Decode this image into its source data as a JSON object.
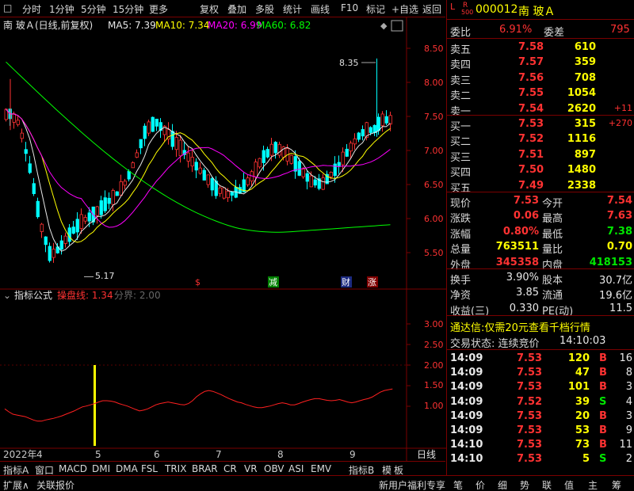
{
  "toolbar": {
    "items": [
      "分时",
      "1分钟",
      "5分钟",
      "15分钟",
      "更多",
      "复权",
      "叠加",
      "多股",
      "统计",
      "画线",
      "F10",
      "标记",
      "+自选",
      "返回"
    ]
  },
  "chart_header": {
    "name": "南 玻Ａ",
    "mode": "(日线,前复权)",
    "ma5": "MA5: 7.39",
    "ma10": "MA10: 7.34",
    "ma20": "MA20: 6.99",
    "ma60": "MA60: 6.82"
  },
  "indicator_header": {
    "title": "指标公式",
    "line_label": "操盘线: 1.34",
    "boundary_label": "分界: 2.00"
  },
  "markers": {
    "high": "8.35",
    "low": "5.17",
    "s_flag": "$",
    "jian": "减",
    "cai": "财",
    "zhang": "涨"
  },
  "chart_data": {
    "type": "candlestick",
    "price_axis": {
      "ticks": [
        "8.50",
        "8.00",
        "7.50",
        "7.00",
        "6.50",
        "6.00",
        "5.50"
      ],
      "min": 5.2,
      "max": 8.5
    },
    "indicator_axis": {
      "ticks": [
        "3.00",
        "2.50",
        "2.00",
        "1.50",
        "1.00"
      ]
    },
    "x_axis": {
      "ticks": [
        "2022年",
        "4",
        "5",
        "6",
        "7",
        "8",
        "9"
      ],
      "period_label": "日线"
    },
    "indicator_values": {
      "operation_line": 1.34,
      "boundary": 2.0
    }
  },
  "stock": {
    "code": "000012",
    "name": "南 玻Ａ",
    "badge_top": "R",
    "badge_mid": "500"
  },
  "order_ratio": {
    "label1": "委比",
    "value1": "6.91%",
    "label2": "委差",
    "value2": "795"
  },
  "asks": [
    {
      "label": "卖五",
      "price": "7.58",
      "vol": "610",
      "chg": ""
    },
    {
      "label": "卖四",
      "price": "7.57",
      "vol": "359",
      "chg": ""
    },
    {
      "label": "卖三",
      "price": "7.56",
      "vol": "708",
      "chg": ""
    },
    {
      "label": "卖二",
      "price": "7.55",
      "vol": "1054",
      "chg": ""
    },
    {
      "label": "卖一",
      "price": "7.54",
      "vol": "2620",
      "chg": "+11"
    }
  ],
  "bids": [
    {
      "label": "买一",
      "price": "7.53",
      "vol": "315",
      "chg": "+270"
    },
    {
      "label": "买二",
      "price": "7.52",
      "vol": "1116",
      "chg": ""
    },
    {
      "label": "买三",
      "price": "7.51",
      "vol": "897",
      "chg": ""
    },
    {
      "label": "买四",
      "price": "7.50",
      "vol": "1480",
      "chg": ""
    },
    {
      "label": "买五",
      "price": "7.49",
      "vol": "2338",
      "chg": ""
    }
  ],
  "stats": [
    {
      "l1": "现价",
      "v1": "7.53",
      "c1": "red",
      "l2": "今开",
      "v2": "7.54",
      "c2": "red"
    },
    {
      "l1": "涨跌",
      "v1": "0.06",
      "c1": "red",
      "l2": "最高",
      "v2": "7.63",
      "c2": "red"
    },
    {
      "l1": "涨幅",
      "v1": "0.80%",
      "c1": "red",
      "l2": "最低",
      "v2": "7.38",
      "c2": "grn"
    },
    {
      "l1": "总量",
      "v1": "763511",
      "c1": "yel",
      "l2": "量比",
      "v2": "0.70",
      "c2": "yel"
    },
    {
      "l1": "外盘",
      "v1": "345358",
      "c1": "red",
      "l2": "内盘",
      "v2": "418153",
      "c2": "grn"
    }
  ],
  "stats2": [
    {
      "l1": "换手",
      "v1": "3.90%",
      "l2": "股本",
      "v2": "30.7亿"
    },
    {
      "l1": "净资",
      "v1": "3.85",
      "l2": "流通",
      "v2": "19.6亿"
    },
    {
      "l1": "收益(三)",
      "v1": "0.330",
      "l2": "PE(动)",
      "v2": "11.5"
    }
  ],
  "promo": "通达信:仅需20元查看千档行情",
  "trade_status": {
    "label": "交易状态: 连续竞价",
    "time": "14:10:03"
  },
  "ticks": [
    {
      "t": "14:09",
      "p": "7.53",
      "v": "120",
      "bs": "B",
      "n": "16"
    },
    {
      "t": "14:09",
      "p": "7.53",
      "v": "47",
      "bs": "B",
      "n": "8"
    },
    {
      "t": "14:09",
      "p": "7.53",
      "v": "101",
      "bs": "B",
      "n": "3"
    },
    {
      "t": "14:09",
      "p": "7.52",
      "v": "39",
      "bs": "S",
      "n": "4"
    },
    {
      "t": "14:09",
      "p": "7.53",
      "v": "20",
      "bs": "B",
      "n": "3"
    },
    {
      "t": "14:09",
      "p": "7.53",
      "v": "53",
      "bs": "B",
      "n": "9"
    },
    {
      "t": "14:10",
      "p": "7.53",
      "v": "73",
      "bs": "B",
      "n": "11"
    },
    {
      "t": "14:10",
      "p": "7.53",
      "v": "5",
      "bs": "S",
      "n": "2"
    }
  ],
  "bottom_tabs": [
    "指标A",
    "窗口",
    "MACD",
    "DMI",
    "DMA",
    "FSL",
    "TRIX",
    "BRAR",
    "CR",
    "VR",
    "OBV",
    "ASI",
    "EMV",
    "指标B",
    "模",
    "板"
  ],
  "status_left": [
    "扩展∧",
    "关联报价"
  ],
  "status_right": "新用户福利专享",
  "right_tabs": [
    "笔",
    "价",
    "细",
    "势",
    "联",
    "值",
    "主",
    "筹"
  ]
}
